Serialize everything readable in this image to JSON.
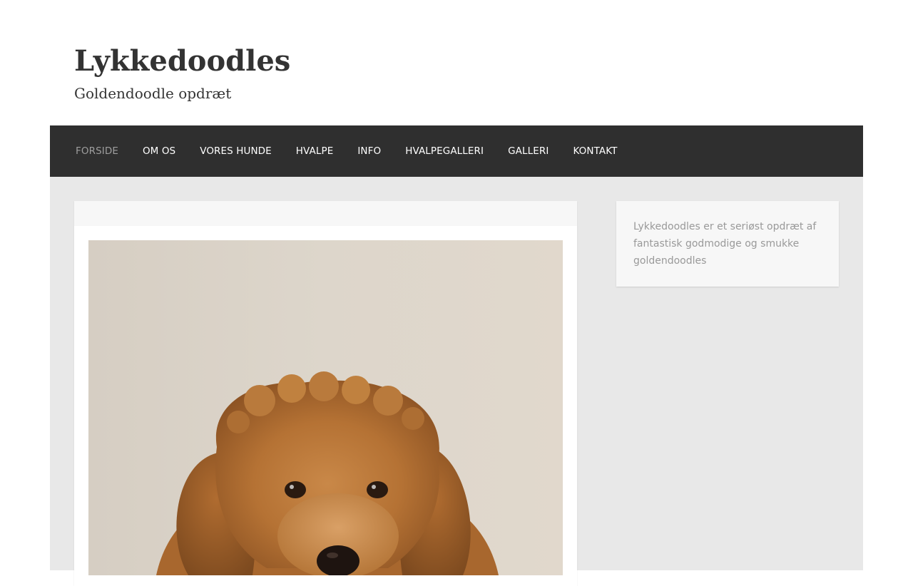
{
  "site": {
    "title": "Lykkedoodles",
    "tagline": "Goldendoodle opdræt"
  },
  "nav": {
    "items": [
      {
        "label": "FORSIDE",
        "active": true
      },
      {
        "label": "OM OS",
        "active": false
      },
      {
        "label": "VORES HUNDE",
        "active": false
      },
      {
        "label": "HVALPE",
        "active": false
      },
      {
        "label": "INFO",
        "active": false
      },
      {
        "label": "HVALPEGALLERI",
        "active": false
      },
      {
        "label": "GALLERI",
        "active": false
      },
      {
        "label": "KONTAKT",
        "active": false
      }
    ]
  },
  "main": {
    "image_subject": "goldendoodle puppy photo"
  },
  "sidebar": {
    "text": "Lykkedoodles er et seriøst opdræt af fantastisk godmodige og smukke goldendoodles"
  },
  "colors": {
    "nav_bg": "#2f2f2f",
    "nav_text": "#ffffff",
    "nav_active": "#9e9e9e",
    "content_bg": "#e8e8e8",
    "title_text": "#333333",
    "sidebar_text": "#999999",
    "puppy_fur": "#b8763a"
  }
}
